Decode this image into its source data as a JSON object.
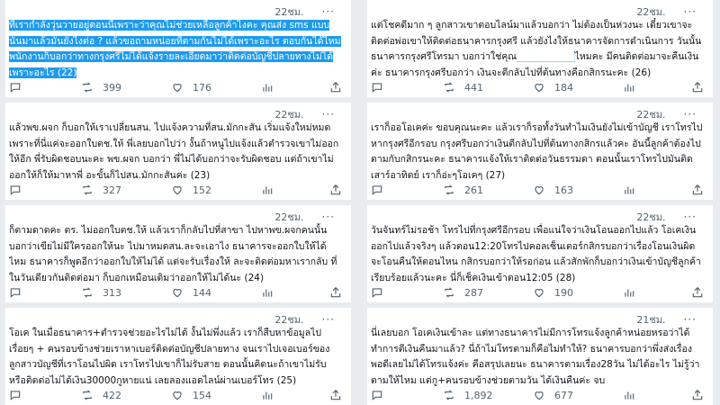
{
  "colors": {
    "background": "#e9ecef",
    "text": "#0f1419",
    "muted": "#536471",
    "highlight": "#1d9bf0"
  },
  "icons": {
    "reply": "reply-icon",
    "retweet": "retweet-icon",
    "like": "like-icon",
    "views": "views-icon",
    "share": "share-icon",
    "more": "more-icon"
  },
  "left": [
    {
      "time": "22ชม.",
      "more": "···",
      "text_pre": "",
      "text_hl": "ที่เรากำลังวุ่นวายอยู่ตอนนี้เพราะว่าคุณไม่ช่วยเหลือลูกค้าไงคะ คุณส่ง sms แบบนั้นมาแล้วมันยังไงต่อ ? แล้วขอถามหน่อยที่ตามกันไม่ได้เพราะอะไร ตอบกันได้ไหม พนักงานก็บอกว่าทางกรุงศรีไม่ได้แจ้งรายละเอียดมาว่าติดต่อบัญชีปลายทางไม่ได้เพราะอะไร (22)",
      "replies": "",
      "retweets": "399",
      "likes": "176",
      "views": ""
    },
    {
      "time": "22ชม.",
      "more": "···",
      "text_pre": "แล้วพข.ผจก ก็บอกให้เราเปลี่ยนสน. ไปแจ้งความที่สน.มักกะสัน เริ่มแจ้งใหม่หมด เพราะที่นี่แค่จะออกใบตช.ให้ พี่เลยบอกไปว่า งั้นถ้าหนูไปแจ้งแล้วตำรวจเขาไม่ออกให้อีก พี่รับผิดชอบนะคะ พข.ผจก บอกว่า พี่ไม่ได้บอกว่าจะรับผิดชอบ แต่ถ้าเขาไม่ออกให้ก็ให้มาหาพี่ อะขั้นก็ไปสน.มักกะสันค่ะ (23)",
      "text_hl": "",
      "replies": "",
      "retweets": "327",
      "likes": "152",
      "views": ""
    },
    {
      "time": "22ชม.",
      "more": "···",
      "text_pre": "ก็ตามดาดคะ ตร. ไม่ออกใบตช.ให้ แล้วเราก็กลับไปที่สาขา ไปหาพข.ผจกคนนั้นบอกว่าเขียไม่มีใครออกให้นะ ไปมาหมดสน.ละจะเอาไง ธนาคารจะออกใบให้ได้ไหม ธนาคารก็พูดอีกว่าออกใบให้ไม่ได้ แต่จะรับเรื่องให้ ละจะติดต่อมหาเรากลับ ที่ ในวันเดียวกันติดต่อมา ก็บอกเหมือนเดิมว่าออกให้ไม่ได้นะ (24)",
      "text_hl": "",
      "replies": "",
      "retweets": "313",
      "likes": "144",
      "views": ""
    },
    {
      "time": "22ชม.",
      "more": "···",
      "text_pre": "โอเค ในเมื่อธนาคาร+ตำรวจช่วยอะไรไม่ได้ งั้นไม่พึ่งแล้ว เราก็สืบหาข้อมูลไปเรื่อยๆ + คนรอบข้างช่วยเราหาเบอร์ติดต่อบัญชีปลายทาง จนเราไปเจอเบอร์ของลูกสาวบัญชีที่เราโอนไปผิด เราโทรไปเขาก็ไม่รับสาย ตอนนั้นคิดนะถ้าเขาไม่รับหรือติดต่อไม่ได้เงิน30000กูหายแน่ เลยลองแอดไลน์ผ่านเบอร์โทร (25)",
      "text_hl": "",
      "replies": "",
      "retweets": "422",
      "likes": "154",
      "views": ""
    }
  ],
  "right": [
    {
      "time": "22ชม.",
      "more": "···",
      "text_pre": "แต่โชคดีมาก ๆ ลูกสาวเขาตอบไลน์มาแล้วบอกว่า ไม่ต้องเป็นห่วงนะ เดี๋ยวเขาจะติดต่อพ่อเขาให้ติดต่อธนาคารกรุงศรี แล้วยังไงให้ธนาคารจัดการดำเนินการ วันนั้น ธนาคารกรุงศรีโทรมา บอกว่าใช่คุณ",
      "text_hl": "████████",
      "text_post": "ไหมคะ มีคนติดต่อมาจะคืนเงินค่ะ ธนาคารกรุงศรีบอกว่า เงินจะตีกลับไปที่ต้นทางคือกสิกรนะคะ (26)",
      "replies": "",
      "retweets": "441",
      "likes": "184",
      "views": ""
    },
    {
      "time": "22ชม.",
      "more": "···",
      "text_pre": "เราก็ออโอเคค่ะ ขอบคุณนะคะ แล้วเราก็รอทั้งวันทำไมเงินยังไม่เข้าบัญชี เราโทรไปหากรุงศรีอีกรอบ กรุงศรีบอกว่าเงินตีกลับไปที่ต้นทางกสิกรแล้วคะ อันนี้ลูกค้าต้องไปตามกับกสิกรนะคะ ธนาคารแจ้งให้เราติดต่อวันธรรมดา ตอนนั้นเราโทรไปมันติดเสาร์อาทิตย์ เราก็อ่ะๆโอเคๆ (27)",
      "text_hl": "",
      "text_post": "",
      "replies": "",
      "retweets": "261",
      "likes": "163",
      "views": ""
    },
    {
      "time": "22ชม.",
      "more": "···",
      "text_pre": "วันจันทร์ไม่รอช้า โทรไปที่กรุงศรีอีกรอบ เพื่อแน่ใจว่าเงินโอนออกไปแล้ว โอเคเงินออกไปแล้วจริงๆ แล้วตอน12:20โทรไปคอลเซ็นเตอร์กสิกรบอกว่าเรื่องโอนเงินผิด จะโอนคืนให้ตอนไหน กสิกรบอกว่าให้รอก่อน แล้วสักพักก็บอกว่าเงินเข้าบัญชีลูกค้าเรียบร้อยแล้วนะคะ นี่ก็เช็คเงินเข้าตอน12:05 (28)",
      "text_hl": "",
      "text_post": "",
      "replies": "",
      "retweets": "287",
      "likes": "190",
      "views": ""
    },
    {
      "time": "21ชม.",
      "more": "···",
      "text_pre": "นี่เลยบอก โอเคเงินเข้าละ แต่ทางธนาคารไม่มีการโทรแจ้งลูกค้าหน่อยหรอว่าได้ทำการตีเงินคืนมาแล้ว? นี่ถ้าไม่โทรตามก็คือไม่ทำให้? ธนาคารบอกว่าพึ่งส่งเรื่องพอดีเลยไม่ได้โทรแจ้งค่ะ คือสรุปเลยนะ ธนาคารตามเรื่อง28วัน ไม่ได้อะไร ไม่รู้ว่าตามให้ไหม แต่กู+คนรอบข้างช่วยตามวัน ได้เงินคืนค่ะ จบ",
      "text_hl": "",
      "text_post": "",
      "replies": "",
      "retweets": "1,892",
      "likes": "677",
      "views": ""
    }
  ]
}
